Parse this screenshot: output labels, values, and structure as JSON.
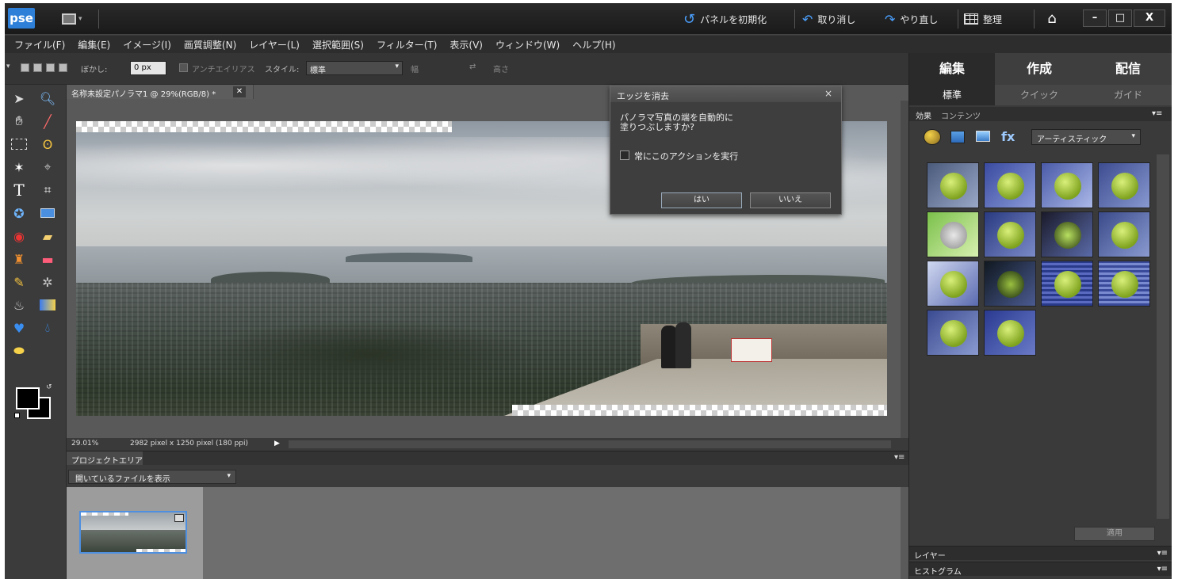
{
  "app": {
    "logo": "pse",
    "reset_panels": "パネルを初期化",
    "undo": "取り消し",
    "redo": "やり直し",
    "organize": "整理",
    "win_min": "–",
    "win_max": "□",
    "win_close": "X"
  },
  "menu": [
    "ファイル(F)",
    "編集(E)",
    "イメージ(I)",
    "画質調整(N)",
    "レイヤー(L)",
    "選択範囲(S)",
    "フィルター(T)",
    "表示(V)",
    "ウィンドウ(W)",
    "ヘルプ(H)"
  ],
  "options": {
    "feather_label": "ぼかし:",
    "feather_value": "0 px",
    "antialias": "アンチエイリアス",
    "style_label": "スタイル:",
    "style_value": "標準",
    "width_label": "幅",
    "height_label": "高さ"
  },
  "document": {
    "tab_title": "名称未設定パノラマ1 @ 29%(RGB/8) *",
    "zoom": "29.01%",
    "info": "2982 pixel x 1250 pixel (180 ppi)"
  },
  "dialog": {
    "title": "エッジを消去",
    "message_line1": "パノラマ写真の端を自動的に",
    "message_line2": "塗りつぶしますか?",
    "checkbox": "常にこのアクションを実行",
    "yes": "はい",
    "no": "いいえ"
  },
  "project": {
    "tab": "プロジェクトエリア",
    "select": "開いているファイルを表示"
  },
  "panel": {
    "tabs": [
      "編集",
      "作成",
      "配信"
    ],
    "subtabs": [
      "標準",
      "クイック",
      "ガイド"
    ],
    "panel_tabs": [
      "効果",
      "コンテンツ"
    ],
    "filter_select": "アーティスティック",
    "apply": "適用",
    "layers": "レイヤー",
    "histogram": "ヒストグラム"
  },
  "colors": {
    "accent": "#2d7fd8",
    "panel_bg": "#3a3a3a",
    "selected_tab": "#2a2a2a"
  }
}
